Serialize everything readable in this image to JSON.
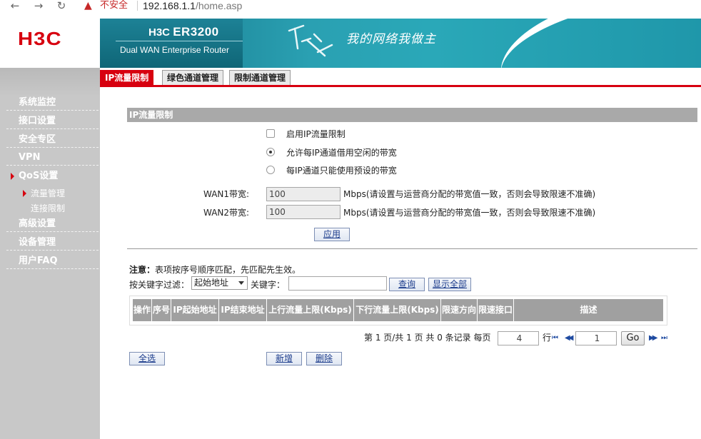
{
  "browser": {
    "back": "←",
    "forward": "→",
    "reload": "↻",
    "warning_icon": "▲",
    "security_label": "不安全",
    "url_host": "192.168.1.1",
    "url_path": "/home.asp"
  },
  "logo": "H3C",
  "banner": {
    "brand": "H3C",
    "model": "ER3200",
    "tagline": "Dual WAN Enterprise Router",
    "slogan": "我的网络我做主"
  },
  "sidebar": {
    "items": [
      {
        "label": "系统监控"
      },
      {
        "label": "接口设置"
      },
      {
        "label": "安全专区"
      },
      {
        "label": "VPN"
      },
      {
        "label": "QoS设置"
      },
      {
        "label": "高级设置"
      },
      {
        "label": "设备管理"
      },
      {
        "label": "用户FAQ"
      }
    ],
    "subitems": [
      {
        "label": "流量管理"
      },
      {
        "label": "连接限制"
      }
    ]
  },
  "tabs": [
    {
      "label": "IP流量限制"
    },
    {
      "label": "绿色通道管理"
    },
    {
      "label": "限制通道管理"
    }
  ],
  "section": {
    "title": "IP流量限制",
    "enable_label": "启用IP流量限制",
    "radio1_label": "允许每IP通道借用空闲的带宽",
    "radio2_label": "每IP通道只能使用预设的带宽",
    "wan1_label": "WAN1带宽:",
    "wan1_value": "100",
    "wan2_label": "WAN2带宽:",
    "wan2_value": "100",
    "unit_hint": "Mbps(请设置与运营商分配的带宽值一致，否则会导致限速不准确)",
    "apply_label": "应用"
  },
  "rules": {
    "note_bold": "注意：",
    "note_text": "表项按序号顺序匹配，先匹配先生效。",
    "filter_label": "按关键字过滤：",
    "filter_select": "起始地址",
    "keyword_label": "关键字：",
    "keyword_value": "",
    "search_label": "查询",
    "show_all_label": "显示全部",
    "columns": [
      "操作",
      "序号",
      "IP起始地址",
      "IP结束地址",
      "上行流量上限(Kbps)",
      "下行流量上限(Kbps)",
      "限速方向",
      "限速接口",
      "描述"
    ],
    "pager_text": "第 1 页/共 1 页 共 0 条记录 每页",
    "per_page": "4",
    "row_unit": "行",
    "page_input": "1",
    "go_label": "Go",
    "first_icon": "⏮",
    "prev_icon": "◀◀",
    "next_icon": "▶▶",
    "last_icon": "⏭",
    "select_all_label": "全选",
    "add_label": "新增",
    "delete_label": "删除"
  }
}
